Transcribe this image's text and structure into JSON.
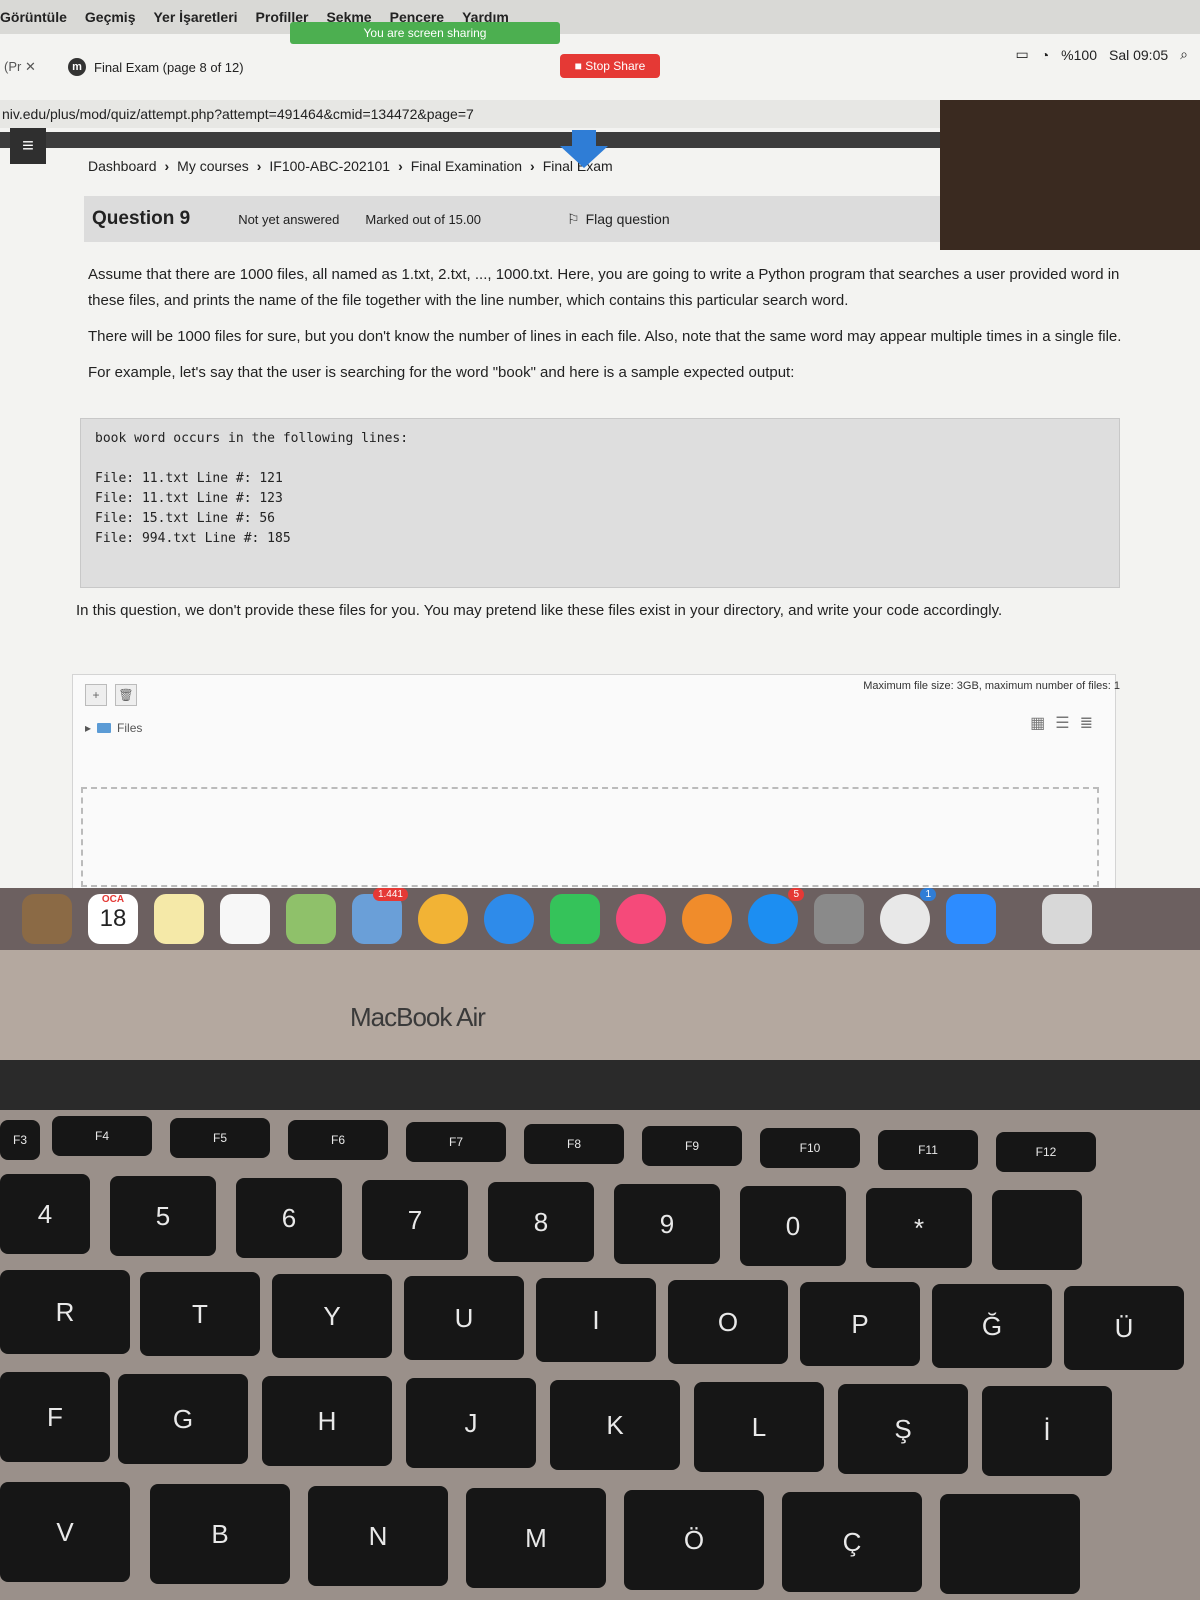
{
  "menubar": {
    "items": [
      "Görüntüle",
      "Geçmiş",
      "Yer İşaretleri",
      "Profiller",
      "Sekme",
      "Pencere",
      "Yardım"
    ]
  },
  "sharing": {
    "status": "You are screen sharing",
    "stop_label": "Stop Share"
  },
  "status_bar": {
    "battery": "%100",
    "clock": "Sal 09:05"
  },
  "tabs": {
    "prev": "(Pr",
    "active": "Final Exam (page 8 of 12)"
  },
  "url": "niv.edu/plus/mod/quiz/attempt.php?attempt=491464&cmid=134472&page=7",
  "breadcrumb": {
    "items": [
      "Dashboard",
      "My courses",
      "IF100-ABC-202101",
      "Final Examination",
      "Final Exam"
    ]
  },
  "question": {
    "title": "Question 9",
    "status": "Not yet answered",
    "marks": "Marked out of 15.00",
    "flag_label": "Flag question",
    "paragraphs": [
      "Assume that there are 1000 files, all named as 1.txt, 2.txt, ..., 1000.txt. Here, you are going to write a Python program that searches a user provided word in these files, and prints the name of the file together with the line number, which contains this particular search word.",
      "There will be 1000 files for sure, but you don't know the number of lines in each file. Also, note that the same word may appear multiple times in a single file.",
      "For example, let's say that the user is searching for the word \"book\" and here is a sample expected output:"
    ],
    "code_lines": [
      "book word occurs in the following lines:",
      "",
      "File: 11.txt Line #: 121",
      "File: 11.txt Line #: 123",
      "File: 15.txt Line #: 56",
      "File: 994.txt Line #: 185"
    ],
    "note": "In this question, we don't provide these files for you. You may pretend like these files exist in your directory, and write your code accordingly."
  },
  "filepicker": {
    "max_size": "Maximum file size: 3GB, maximum number of files: 1",
    "files_label": "Files"
  },
  "dock": {
    "calendar_month": "OCA",
    "calendar_day": "18",
    "photos_badge": "1.441",
    "appstore_badge": "5",
    "chrome_badge": "1"
  },
  "laptop": {
    "label": "MacBook Air"
  },
  "keyboard": {
    "fkeys": [
      "F3",
      "F4",
      "F5",
      "F6",
      "F7",
      "F8",
      "F9",
      "F10",
      "F11",
      "F12"
    ],
    "numbers": [
      "4",
      "5",
      "6",
      "7",
      "8",
      "9",
      "0",
      "*"
    ],
    "row2": [
      "R",
      "T",
      "Y",
      "U",
      "I",
      "O",
      "P",
      "Ğ",
      "Ü"
    ],
    "row3": [
      "F",
      "G",
      "H",
      "J",
      "K",
      "L",
      "Ş",
      "İ"
    ],
    "row4": [
      "V",
      "B",
      "N",
      "M",
      "Ö",
      "Ç"
    ]
  },
  "colors": {
    "share_green": "#4caf50",
    "stop_red": "#e53935",
    "drop_arrow": "#2f7dd6"
  }
}
